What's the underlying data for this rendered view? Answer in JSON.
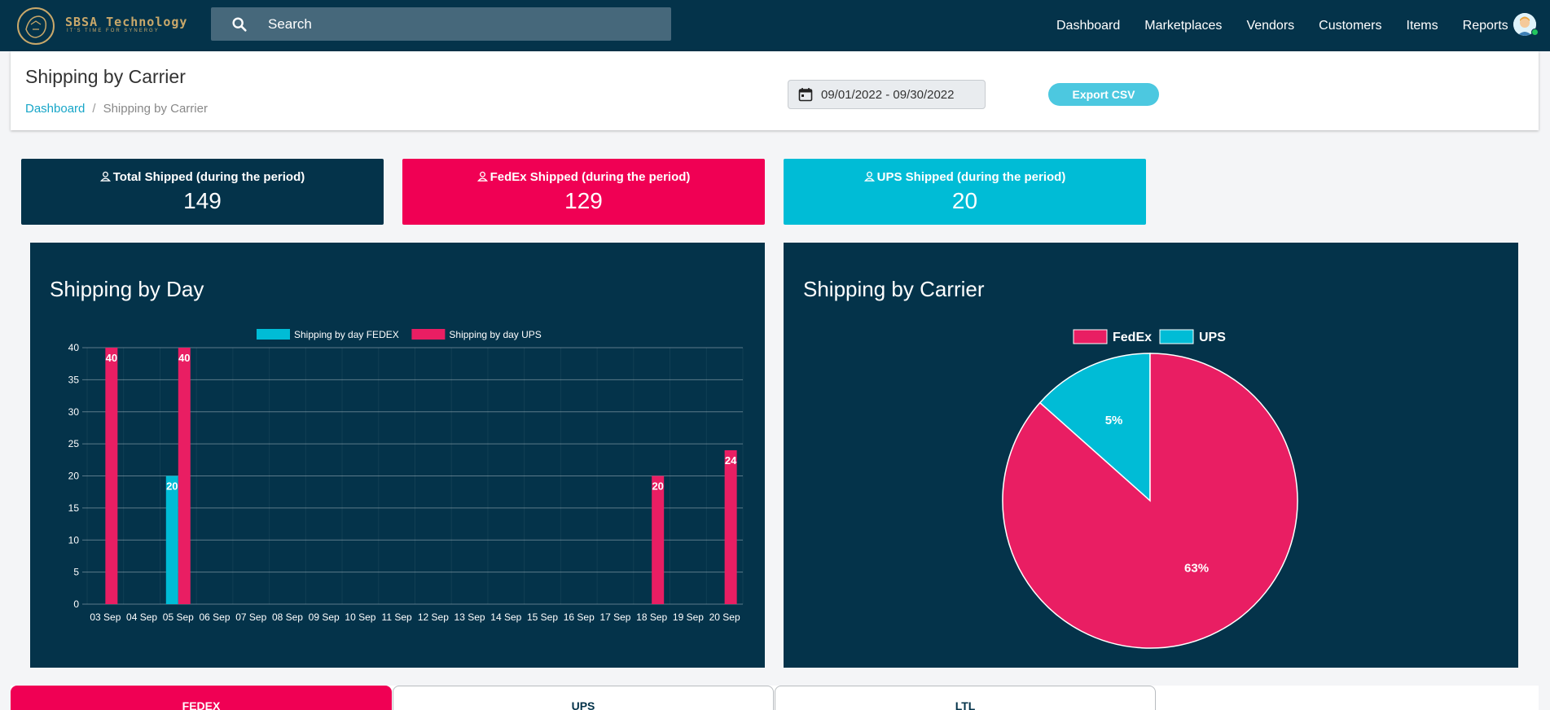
{
  "brand": {
    "name": "SBSA Technology",
    "tagline": "IT'S TIME FOR SYNERGY"
  },
  "search": {
    "placeholder": "Search"
  },
  "nav": {
    "items": [
      "Dashboard",
      "Marketplaces",
      "Vendors",
      "Customers",
      "Items",
      "Reports"
    ]
  },
  "page": {
    "title": "Shipping by Carrier",
    "breadcrumb": [
      "Dashboard",
      "Shipping by Carrier"
    ],
    "date_range": "09/01/2022 - 09/30/2022",
    "export_label": "Export CSV"
  },
  "stats": [
    {
      "label": "Total Shipped (during the period)",
      "value": "149"
    },
    {
      "label": "FedEx Shipped (during the period)",
      "value": "129"
    },
    {
      "label": "UPS Shipped (during the period)",
      "value": "20"
    }
  ],
  "panels": {
    "day_title": "Shipping by Day",
    "carrier_title": "Shipping by Carrier"
  },
  "tabs": [
    "FEDEX",
    "UPS",
    "LTL"
  ],
  "colors": {
    "navy": "#04334a",
    "fedex": "#e91e63",
    "ups": "#00bcd6",
    "accent": "#f00054"
  },
  "chart_data": [
    {
      "type": "bar",
      "title": "Shipping by Day",
      "categories": [
        "03 Sep",
        "04 Sep",
        "05 Sep",
        "06 Sep",
        "07 Sep",
        "08 Sep",
        "09 Sep",
        "10 Sep",
        "11 Sep",
        "12 Sep",
        "13 Sep",
        "14 Sep",
        "15 Sep",
        "16 Sep",
        "17 Sep",
        "18 Sep",
        "19 Sep",
        "20 Sep"
      ],
      "series": [
        {
          "name": "Shipping by day FEDEX",
          "color": "#00bcd6",
          "values": [
            0,
            0,
            20,
            0,
            0,
            0,
            0,
            0,
            0,
            0,
            0,
            0,
            0,
            0,
            0,
            0,
            0,
            0
          ]
        },
        {
          "name": "Shipping by day UPS",
          "color": "#e91e63",
          "values": [
            40,
            0,
            40,
            0,
            0,
            0,
            0,
            0,
            0,
            0,
            0,
            0,
            0,
            0,
            0,
            20,
            0,
            24
          ]
        }
      ],
      "ylim": [
        0,
        40
      ],
      "yticks": [
        0,
        5,
        10,
        15,
        20,
        25,
        30,
        35,
        40
      ],
      "legend": "top",
      "grid": true
    },
    {
      "type": "pie",
      "title": "Shipping by Carrier",
      "categories": [
        "FedEx",
        "UPS"
      ],
      "values": [
        129,
        20
      ],
      "labels": [
        "63%",
        "5%"
      ],
      "colors": [
        "#e91e63",
        "#00bcd6"
      ],
      "legend": "top"
    }
  ]
}
